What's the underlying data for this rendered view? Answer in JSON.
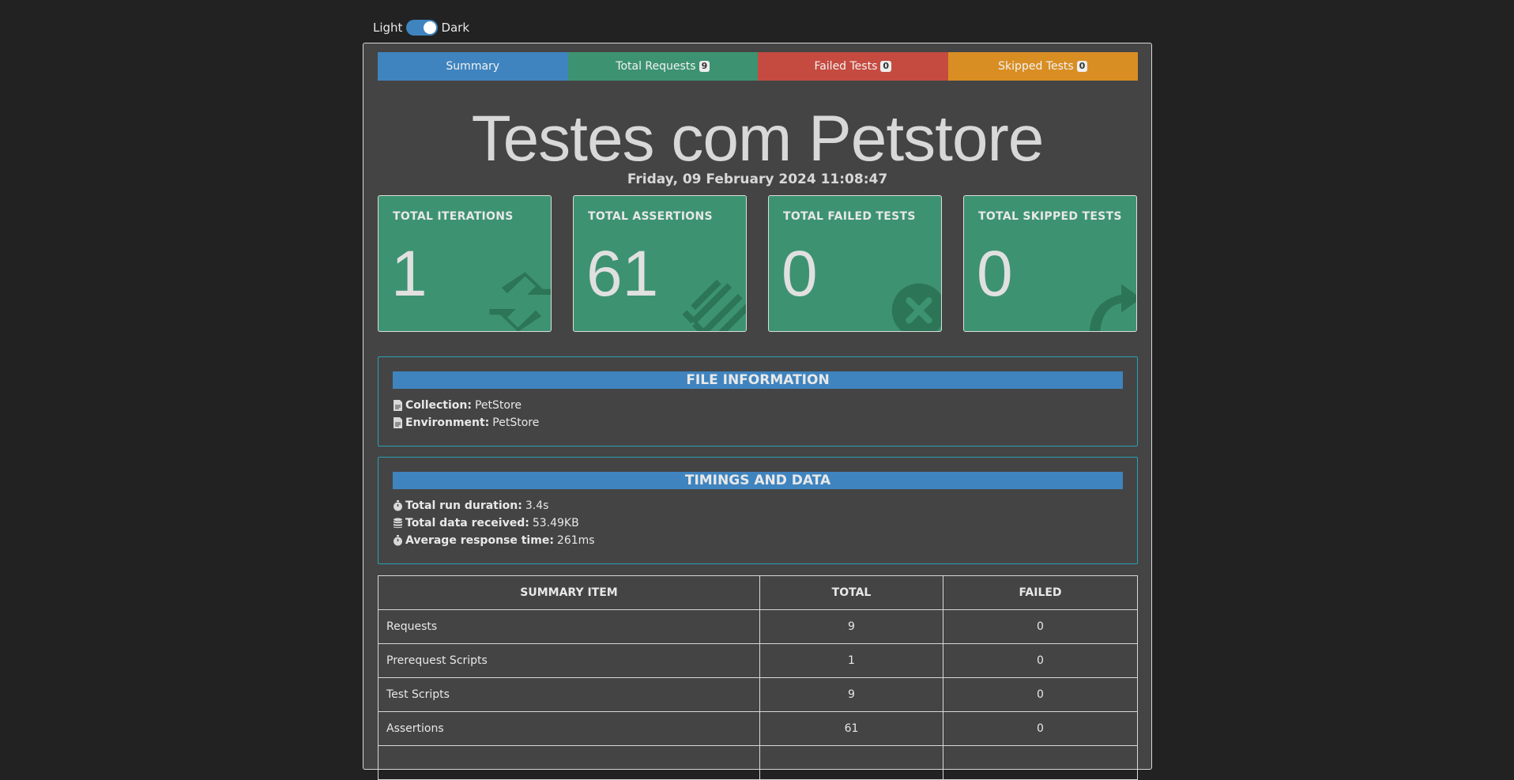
{
  "theme_toggle": {
    "light_label": "Light",
    "dark_label": "Dark",
    "state": "dark"
  },
  "tabs": [
    {
      "label": "Summary",
      "count": null
    },
    {
      "label": "Total Requests",
      "count": "9"
    },
    {
      "label": "Failed Tests",
      "count": "0"
    },
    {
      "label": "Skipped Tests",
      "count": "0"
    }
  ],
  "title": "Testes com Petstore",
  "date": "Friday, 09 February 2024 11:08:47",
  "cards": [
    {
      "label": "TOTAL ITERATIONS",
      "value": "1",
      "icon": "refresh-icon"
    },
    {
      "label": "TOTAL ASSERTIONS",
      "value": "61",
      "icon": "check-list-icon"
    },
    {
      "label": "TOTAL FAILED TESTS",
      "value": "0",
      "icon": "times-circle-icon"
    },
    {
      "label": "TOTAL SKIPPED TESTS",
      "value": "0",
      "icon": "share-arrow-icon"
    }
  ],
  "file_info": {
    "header": "FILE INFORMATION",
    "collection_label": "Collection:",
    "collection_value": "PetStore",
    "environment_label": "Environment:",
    "environment_value": "PetStore"
  },
  "timings": {
    "header": "TIMINGS AND DATA",
    "duration_label": "Total run duration:",
    "duration_value": "3.4s",
    "data_label": "Total data received:",
    "data_value": "53.49KB",
    "avg_label": "Average response time:",
    "avg_value": "261ms"
  },
  "summary_table": {
    "headers": [
      "SUMMARY ITEM",
      "TOTAL",
      "FAILED"
    ],
    "rows": [
      {
        "item": "Requests",
        "total": "9",
        "failed": "0"
      },
      {
        "item": "Prerequest Scripts",
        "total": "1",
        "failed": "0"
      },
      {
        "item": "Test Scripts",
        "total": "9",
        "failed": "0"
      },
      {
        "item": "Assertions",
        "total": "61",
        "failed": "0"
      }
    ]
  },
  "colors": {
    "page_bg": "#222222",
    "panel_bg": "#444444",
    "summary_tab": "#3f84bf",
    "requests_tab": "#3d9371",
    "failed_tab": "#c54b40",
    "skipped_tab": "#d98e23",
    "card_bg": "#3d9371",
    "panel_border": "#2aa1b3"
  }
}
